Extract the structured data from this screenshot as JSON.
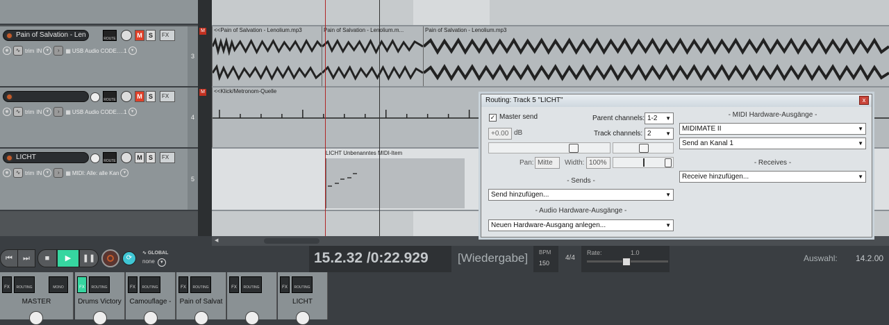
{
  "tracks": [
    {
      "num": "3",
      "name": "Pain of Salvation - Len",
      "input": "USB Audio CODE….1",
      "trim": "trim",
      "in": "IN",
      "mute_active": true
    },
    {
      "num": "4",
      "name": "",
      "input": "USB Audio CODE….1",
      "trim": "trim",
      "in": "IN",
      "mute_active": true
    },
    {
      "num": "5",
      "name": "LICHT",
      "input": "MIDI: Alle: alle Kan",
      "trim": "trim",
      "in": "IN",
      "mute_active": false
    }
  ],
  "track_buttons": {
    "route": "ROUTE",
    "mute": "M",
    "solo": "S",
    "fx": "FX",
    "env_marker": "M"
  },
  "items": {
    "lane3": [
      "<<Pain of Salvation - Lenolium.mp3",
      "Pain of Salvation - Lenolium.m...",
      "Pain of Salvation - Lenolium.mp3"
    ],
    "lane4": [
      "<<Klick/Metronom-Quelle"
    ],
    "lane5": [
      "LICHT Unbenanntes MIDI-Item"
    ]
  },
  "transport": {
    "time": "15.2.32 /0:22.929",
    "status": "[Wiedergabe]",
    "bpm_label": "BPM",
    "bpm": "150",
    "time_sig": "4/4",
    "rate_label": "Rate:",
    "rate": "1.0",
    "global_label": "GLOBAL",
    "global_value": "none",
    "selection_label": "Auswahl:",
    "selection_value": "14.2.00"
  },
  "mixer": {
    "strips": [
      {
        "name": "MASTER",
        "routing": "ROUTING",
        "extra": "MONO"
      },
      {
        "name": "Drums Victory",
        "routing": "ROUTING"
      },
      {
        "name": "Camouflage - ",
        "routing": "ROUTING"
      },
      {
        "name": "Pain of Salvat",
        "routing": "ROUTING"
      },
      {
        "name": "",
        "routing": "ROUTING"
      },
      {
        "name": "LICHT",
        "routing": "ROUTING"
      }
    ],
    "fx": "FX"
  },
  "routing_dialog": {
    "title": "Routing: Track 5 \"LICHT\"",
    "close": "x",
    "master_send": "Master send",
    "parent_channels_label": "Parent channels:",
    "parent_channels": "1-2",
    "track_channels_label": "Track channels:",
    "track_channels": "2",
    "volume": "+0.00",
    "db": "dB",
    "pan_label": "Pan:",
    "pan": "Mitte",
    "width_label": "Width:",
    "width": "100%",
    "sends_header": "- Sends -",
    "sends_select": "Send hinzufügen...",
    "audio_hw_header": "- Audio Hardware-Ausgänge -",
    "audio_hw_select": "Neuen Hardware-Ausgang anlegen...",
    "midi_hw_header": "- MIDI Hardware-Ausgänge -",
    "midi_device": "MIDIMATE II",
    "midi_channel": "Send an Kanal 1",
    "receives_header": "- Receives -",
    "receives_select": "Receive hinzufügen..."
  },
  "colors": {
    "accent_play": "#36d6a0",
    "mute_red": "#e04028",
    "record": "#c25a2a"
  }
}
